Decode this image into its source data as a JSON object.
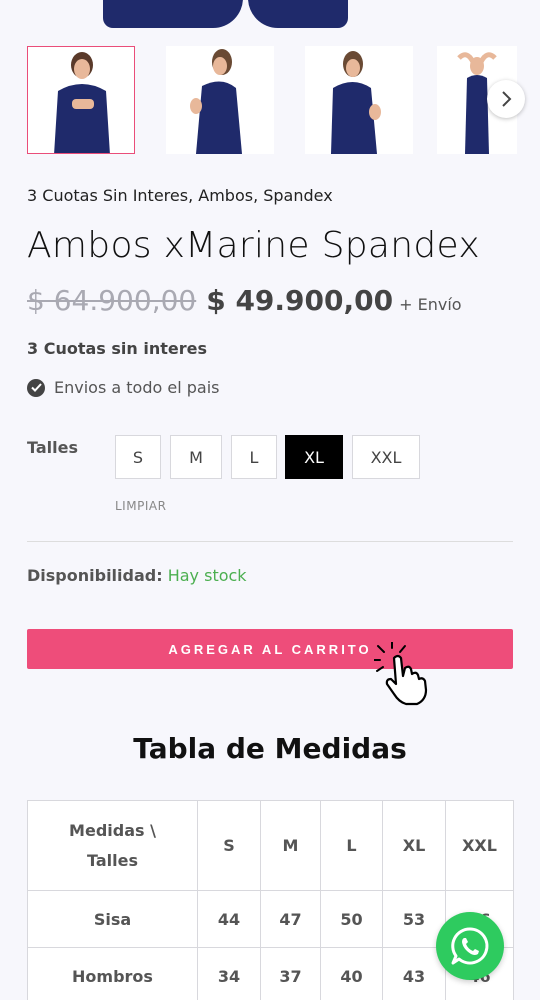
{
  "gallery": {
    "thumbnails": [
      "thumbnail-front-hands-on-chest",
      "thumbnail-side-view",
      "thumbnail-side-front-view",
      "thumbnail-arms-raised"
    ],
    "active_index": 0,
    "next_icon": "chevron-right-icon"
  },
  "product": {
    "category": "3 Cuotas Sin Interes, Ambos, Spandex",
    "title": "Ambos xMarine Spandex",
    "old_price": "$ 64.900,00",
    "price": "$ 49.900,00",
    "shipping": "+ Envío",
    "cuotas": "3 Cuotas sin interes",
    "envios": "Envios a todo el pais",
    "envios_icon": "check-circle-icon"
  },
  "sizes": {
    "label": "Talles",
    "options": [
      "S",
      "M",
      "L",
      "XL",
      "XXL"
    ],
    "selected": "XL",
    "clear_label": "LIMPIAR"
  },
  "availability": {
    "label": "Disponibilidad:",
    "value": "Hay stock",
    "value_color": "#4caf50"
  },
  "cart": {
    "button_label": "AGREGAR AL CARRITO",
    "button_color": "#ee4d7a",
    "pointer_icon": "hand-pointer-icon"
  },
  "measures": {
    "title": "Tabla de Medidas",
    "header_corner_line1": "Medidas \\",
    "header_corner_line2": "Talles",
    "columns": [
      "S",
      "M",
      "L",
      "XL",
      "XXL"
    ],
    "rows": [
      {
        "label": "Sisa",
        "values": [
          "44",
          "47",
          "50",
          "53",
          "56"
        ]
      },
      {
        "label": "Hombros",
        "values": [
          "34",
          "37",
          "40",
          "43",
          "46"
        ]
      }
    ]
  },
  "whatsapp": {
    "icon": "whatsapp-icon",
    "color": "#2ecb5f"
  }
}
